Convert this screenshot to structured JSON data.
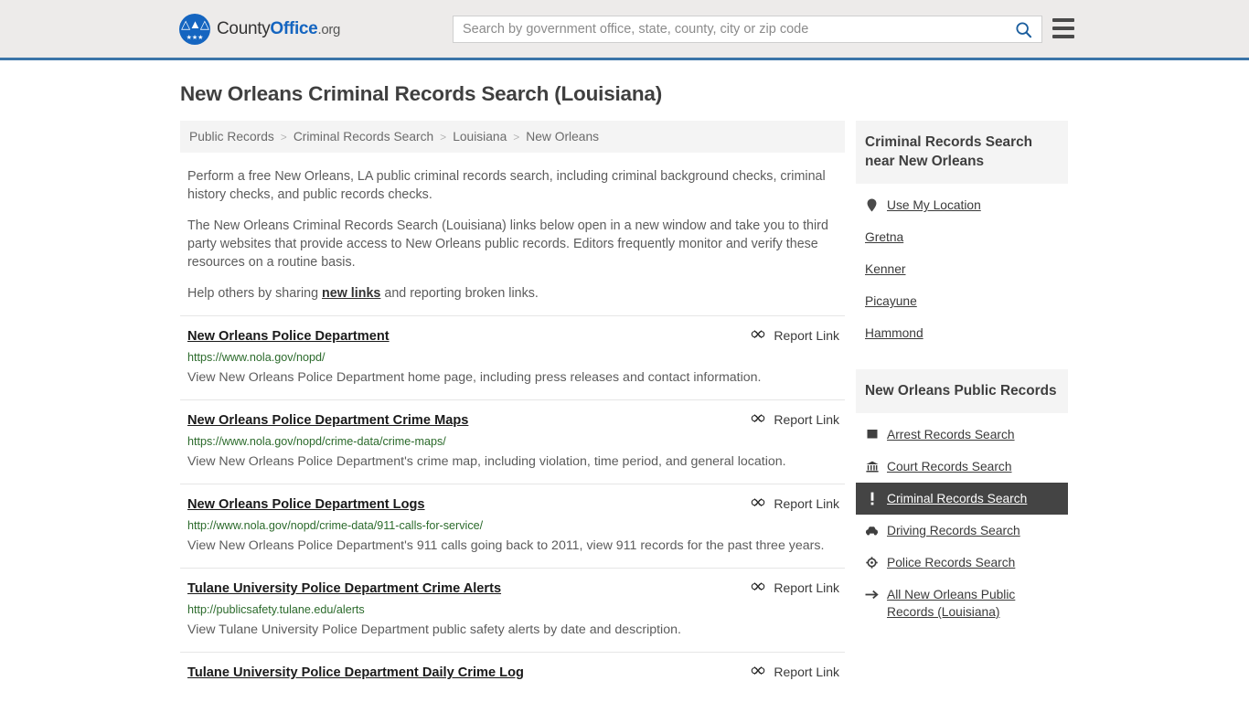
{
  "header": {
    "logo": {
      "name_part_a": "County",
      "name_part_b": "Office",
      "tld": ".org",
      "icon": "eagle-seal-icon"
    },
    "search": {
      "placeholder": "Search by government office, state, county, city or zip code",
      "value": "",
      "icon": "search-icon"
    },
    "menu_icon": "hamburger-menu-icon",
    "accent_color": "#3a74a8",
    "background_color": "#edebea"
  },
  "page": {
    "title": "New Orleans Criminal Records Search (Louisiana)"
  },
  "breadcrumb": {
    "separator": ">",
    "items": [
      {
        "label": "Public Records"
      },
      {
        "label": "Criminal Records Search"
      },
      {
        "label": "Louisiana"
      },
      {
        "label": "New Orleans"
      }
    ]
  },
  "intro": {
    "p1": "Perform a free New Orleans, LA public criminal records search, including criminal background checks, criminal history checks, and public records checks.",
    "p2": "The New Orleans Criminal Records Search (Louisiana) links below open in a new window and take you to third party websites that provide access to New Orleans public records. Editors frequently monitor and verify these resources on a routine basis.",
    "p3_before": "Help others by sharing ",
    "p3_link": "new links",
    "p3_after": " and reporting broken links."
  },
  "results": {
    "report_label": "Report Link",
    "report_icon": "broken-link-icon",
    "items": [
      {
        "title": "New Orleans Police Department",
        "url": "https://www.nola.gov/nopd/",
        "description": "View New Orleans Police Department home page, including press releases and contact information."
      },
      {
        "title": "New Orleans Police Department Crime Maps",
        "url": "https://www.nola.gov/nopd/crime-data/crime-maps/",
        "description": "View New Orleans Police Department's crime map, including violation, time period, and general location."
      },
      {
        "title": "New Orleans Police Department Logs",
        "url": "http://www.nola.gov/nopd/crime-data/911-calls-for-service/",
        "description": "View New Orleans Police Department's 911 calls going back to 2011, view 911 records for the past three years."
      },
      {
        "title": "Tulane University Police Department Crime Alerts",
        "url": "http://publicsafety.tulane.edu/alerts",
        "description": "View Tulane University Police Department public safety alerts by date and description."
      },
      {
        "title": "Tulane University Police Department Daily Crime Log",
        "url": "",
        "description": ""
      }
    ]
  },
  "sidebar": {
    "nearby": {
      "heading": "Criminal Records Search near New Orleans",
      "items": [
        {
          "label": "Use My Location",
          "icon": "map-pin-icon"
        },
        {
          "label": "Gretna",
          "icon": ""
        },
        {
          "label": "Kenner",
          "icon": ""
        },
        {
          "label": "Picayune",
          "icon": ""
        },
        {
          "label": "Hammond",
          "icon": ""
        }
      ]
    },
    "public_records": {
      "heading": "New Orleans Public Records",
      "items": [
        {
          "label": "Arrest Records Search",
          "icon": "handcuffs-icon",
          "active": false
        },
        {
          "label": "Court Records Search",
          "icon": "courthouse-icon",
          "active": false
        },
        {
          "label": "Criminal Records Search",
          "icon": "alert-exclamation-icon",
          "active": true
        },
        {
          "label": "Driving Records Search",
          "icon": "car-icon",
          "active": false
        },
        {
          "label": "Police Records Search",
          "icon": "police-badge-icon",
          "active": false
        },
        {
          "label": "All New Orleans Public Records (Louisiana)",
          "icon": "arrow-right-icon",
          "active": false
        }
      ]
    },
    "active_background_color": "#444444"
  }
}
